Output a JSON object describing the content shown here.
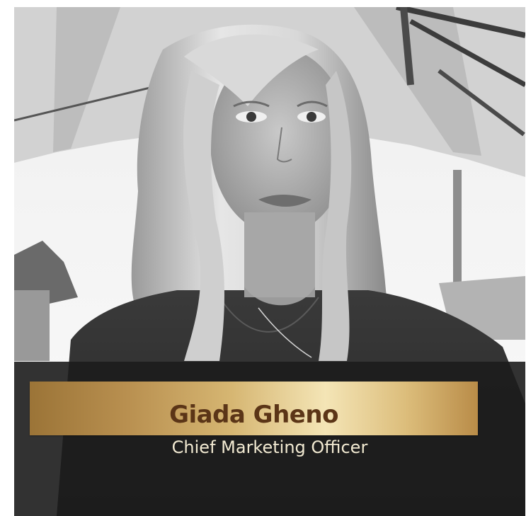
{
  "profile": {
    "name": "Giada Gheno",
    "role": "Chief Marketing Officer",
    "photo_description": "Black and white selfie portrait of a woman with wavy light hair in front of a patio umbrella"
  },
  "colors": {
    "name_text": "#5b3517",
    "role_text": "#f2ead2",
    "overlay": "#1c1c1c",
    "gold_light": "#f4e5b6",
    "gold_dark": "#9b7437"
  }
}
